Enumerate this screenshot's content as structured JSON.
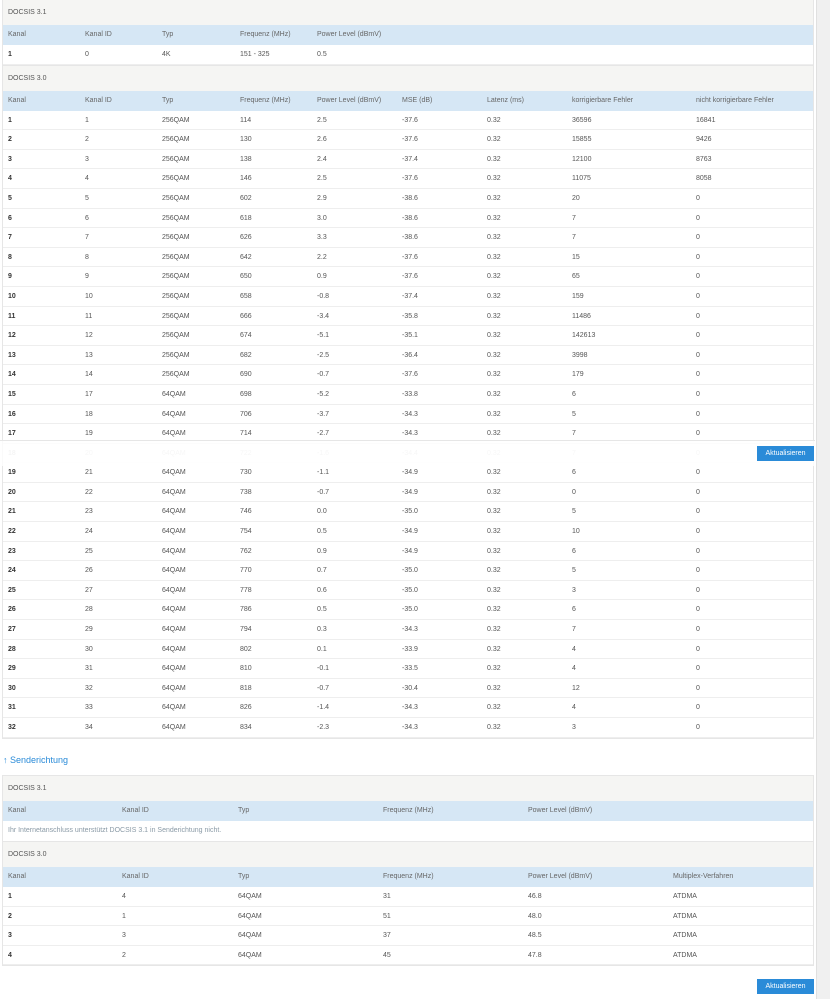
{
  "downstream": {
    "docsis31": {
      "title": "DOCSIS 3.1",
      "headers": [
        "Kanal",
        "Kanal ID",
        "Typ",
        "Frequenz (MHz)",
        "Power Level (dBmV)"
      ],
      "rows": [
        [
          "1",
          "0",
          "4K",
          "151 - 325",
          "0.5"
        ]
      ]
    },
    "docsis30": {
      "title": "DOCSIS 3.0",
      "headers": [
        "Kanal",
        "Kanal ID",
        "Typ",
        "Frequenz (MHz)",
        "Power Level (dBmV)",
        "MSE (dB)",
        "Latenz (ms)",
        "korrigierbare Fehler",
        "nicht korrigierbare Fehler"
      ],
      "rows": [
        [
          "1",
          "1",
          "256QAM",
          "114",
          "2.5",
          "-37.6",
          "0.32",
          "36596",
          "16841"
        ],
        [
          "2",
          "2",
          "256QAM",
          "130",
          "2.6",
          "-37.6",
          "0.32",
          "15855",
          "9426"
        ],
        [
          "3",
          "3",
          "256QAM",
          "138",
          "2.4",
          "-37.4",
          "0.32",
          "12100",
          "8763"
        ],
        [
          "4",
          "4",
          "256QAM",
          "146",
          "2.5",
          "-37.6",
          "0.32",
          "11075",
          "8058"
        ],
        [
          "5",
          "5",
          "256QAM",
          "602",
          "2.9",
          "-38.6",
          "0.32",
          "20",
          "0"
        ],
        [
          "6",
          "6",
          "256QAM",
          "618",
          "3.0",
          "-38.6",
          "0.32",
          "7",
          "0"
        ],
        [
          "7",
          "7",
          "256QAM",
          "626",
          "3.3",
          "-38.6",
          "0.32",
          "7",
          "0"
        ],
        [
          "8",
          "8",
          "256QAM",
          "642",
          "2.2",
          "-37.6",
          "0.32",
          "15",
          "0"
        ],
        [
          "9",
          "9",
          "256QAM",
          "650",
          "0.9",
          "-37.6",
          "0.32",
          "65",
          "0"
        ],
        [
          "10",
          "10",
          "256QAM",
          "658",
          "-0.8",
          "-37.4",
          "0.32",
          "159",
          "0"
        ],
        [
          "11",
          "11",
          "256QAM",
          "666",
          "-3.4",
          "-35.8",
          "0.32",
          "11486",
          "0"
        ],
        [
          "12",
          "12",
          "256QAM",
          "674",
          "-5.1",
          "-35.1",
          "0.32",
          "142613",
          "0"
        ],
        [
          "13",
          "13",
          "256QAM",
          "682",
          "-2.5",
          "-36.4",
          "0.32",
          "3998",
          "0"
        ],
        [
          "14",
          "14",
          "256QAM",
          "690",
          "-0.7",
          "-37.6",
          "0.32",
          "179",
          "0"
        ],
        [
          "15",
          "17",
          "64QAM",
          "698",
          "-5.2",
          "-33.8",
          "0.32",
          "6",
          "0"
        ],
        [
          "16",
          "18",
          "64QAM",
          "706",
          "-3.7",
          "-34.3",
          "0.32",
          "5",
          "0"
        ],
        [
          "17",
          "19",
          "64QAM",
          "714",
          "-2.7",
          "-34.3",
          "0.32",
          "7",
          "0"
        ],
        [
          "18",
          "20",
          "64QAM",
          "722",
          "-1.6",
          "-34.4",
          "0.32",
          "7",
          "0"
        ],
        [
          "19",
          "21",
          "64QAM",
          "730",
          "-1.1",
          "-34.9",
          "0.32",
          "6",
          "0"
        ],
        [
          "20",
          "22",
          "64QAM",
          "738",
          "-0.7",
          "-34.9",
          "0.32",
          "0",
          "0"
        ],
        [
          "21",
          "23",
          "64QAM",
          "746",
          "0.0",
          "-35.0",
          "0.32",
          "5",
          "0"
        ],
        [
          "22",
          "24",
          "64QAM",
          "754",
          "0.5",
          "-34.9",
          "0.32",
          "10",
          "0"
        ],
        [
          "23",
          "25",
          "64QAM",
          "762",
          "0.9",
          "-34.9",
          "0.32",
          "6",
          "0"
        ],
        [
          "24",
          "26",
          "64QAM",
          "770",
          "0.7",
          "-35.0",
          "0.32",
          "5",
          "0"
        ],
        [
          "25",
          "27",
          "64QAM",
          "778",
          "0.6",
          "-35.0",
          "0.32",
          "3",
          "0"
        ],
        [
          "26",
          "28",
          "64QAM",
          "786",
          "0.5",
          "-35.0",
          "0.32",
          "6",
          "0"
        ],
        [
          "27",
          "29",
          "64QAM",
          "794",
          "0.3",
          "-34.3",
          "0.32",
          "7",
          "0"
        ],
        [
          "28",
          "30",
          "64QAM",
          "802",
          "0.1",
          "-33.9",
          "0.32",
          "4",
          "0"
        ],
        [
          "29",
          "31",
          "64QAM",
          "810",
          "-0.1",
          "-33.5",
          "0.32",
          "4",
          "0"
        ],
        [
          "30",
          "32",
          "64QAM",
          "818",
          "-0.7",
          "-30.4",
          "0.32",
          "12",
          "0"
        ],
        [
          "31",
          "33",
          "64QAM",
          "826",
          "-1.4",
          "-34.3",
          "0.32",
          "4",
          "0"
        ],
        [
          "32",
          "34",
          "64QAM",
          "834",
          "-2.3",
          "-34.3",
          "0.32",
          "3",
          "0"
        ]
      ]
    }
  },
  "upstream_link": "↑ Senderichtung",
  "upstream": {
    "docsis31": {
      "title": "DOCSIS 3.1",
      "headers": [
        "Kanal",
        "Kanal ID",
        "Typ",
        "Frequenz (MHz)",
        "Power Level (dBmV)"
      ],
      "note": "Ihr Internetanschluss unterstützt DOCSIS 3.1 in Senderichtung nicht."
    },
    "docsis30": {
      "title": "DOCSIS 3.0",
      "headers": [
        "Kanal",
        "Kanal ID",
        "Typ",
        "Frequenz (MHz)",
        "Power Level (dBmV)",
        "Multiplex-Verfahren"
      ],
      "rows": [
        [
          "1",
          "4",
          "64QAM",
          "31",
          "46.8",
          "ATDMA"
        ],
        [
          "2",
          "1",
          "64QAM",
          "51",
          "48.0",
          "ATDMA"
        ],
        [
          "3",
          "3",
          "64QAM",
          "37",
          "48.5",
          "ATDMA"
        ],
        [
          "4",
          "2",
          "64QAM",
          "45",
          "47.8",
          "ATDMA"
        ]
      ]
    }
  },
  "refresh_label": "Aktualisieren",
  "colors": {
    "accent": "#2a8bd8",
    "header_bg": "#d6e7f5"
  }
}
